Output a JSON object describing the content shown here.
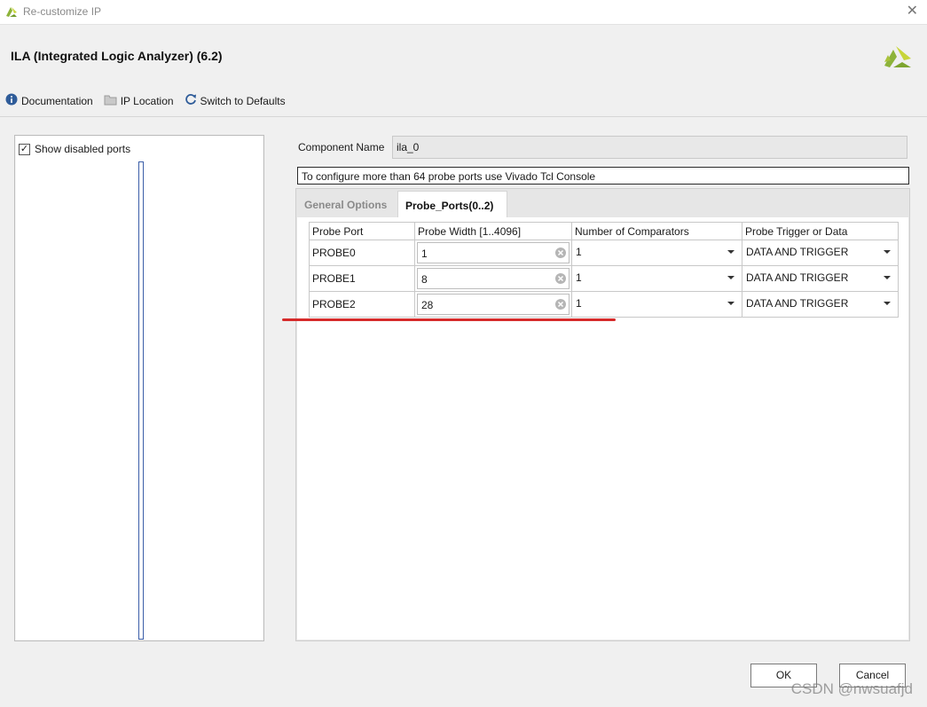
{
  "window": {
    "title": "Re-customize IP",
    "close_glyph": "✕"
  },
  "header": {
    "ip_title": "ILA (Integrated Logic Analyzer) (6.2)",
    "toolbar": [
      {
        "label": "Documentation",
        "icon": "info-icon"
      },
      {
        "label": "IP Location",
        "icon": "folder-icon"
      },
      {
        "label": "Switch to Defaults",
        "icon": "refresh-icon"
      }
    ]
  },
  "left_panel": {
    "show_disabled_ports": {
      "label": "Show disabled ports",
      "checked": true,
      "check_glyph": "✓"
    }
  },
  "component": {
    "label": "Component Name",
    "value": "ila_0"
  },
  "note": "To configure more than 64 probe ports use Vivado Tcl Console",
  "tabs": [
    {
      "label": "General Options",
      "active": false
    },
    {
      "label": "Probe_Ports(0..2)",
      "active": true
    }
  ],
  "probe_table": {
    "headers": [
      "Probe Port",
      "Probe Width [1..4096]",
      "Number of Comparators",
      "Probe Trigger or Data"
    ],
    "rows": [
      {
        "port": "PROBE0",
        "width": "1",
        "comparators": "1",
        "trigger": "DATA AND TRIGGER"
      },
      {
        "port": "PROBE1",
        "width": "8",
        "comparators": "1",
        "trigger": "DATA AND TRIGGER"
      },
      {
        "port": "PROBE2",
        "width": "28",
        "comparators": "1",
        "trigger": "DATA AND TRIGGER"
      }
    ]
  },
  "buttons": {
    "ok": "OK",
    "cancel": "Cancel"
  },
  "watermark": "CSDN @nwsuafjd",
  "colors": {
    "brand_green": "#8db33a",
    "brand_yellow": "#c8d53a",
    "annotation_red": "#d62b2b",
    "info_blue": "#2f5c99"
  }
}
